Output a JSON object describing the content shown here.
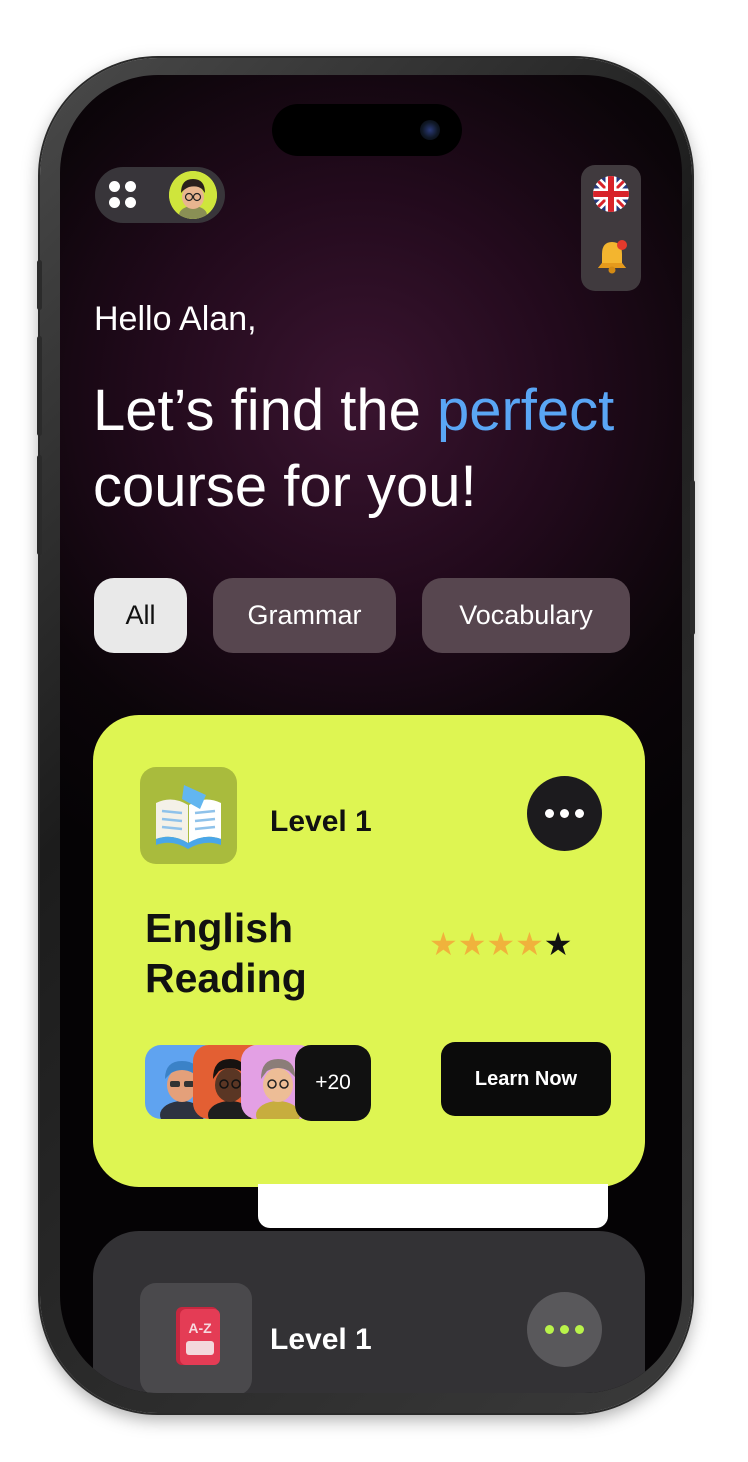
{
  "greeting": "Hello Alan,",
  "headline": {
    "part1": "Let’s find the ",
    "accent": "perfect",
    "part2": "course for you!"
  },
  "filters": [
    "All",
    "Grammar",
    "Vocabulary"
  ],
  "selected_filter": "All",
  "course_card": {
    "level": "Level 1",
    "title_line1": "English",
    "title_line2": "Reading",
    "rating": 4,
    "rating_max": 5,
    "extra_learners": "+20",
    "cta": "Learn Now"
  },
  "next_card": {
    "level": "Level 1",
    "icon_text": "A-Z"
  },
  "colors": {
    "accent_blue": "#5aa6f5",
    "card_lime": "#def552",
    "star_filled": "#f0b23c",
    "star_empty": "#111111"
  },
  "icons": {
    "menu": "grid-dots-icon",
    "language": "uk-flag-icon",
    "notifications": "bell-icon",
    "course": "open-book-icon",
    "more": "more-horizontal-icon"
  }
}
